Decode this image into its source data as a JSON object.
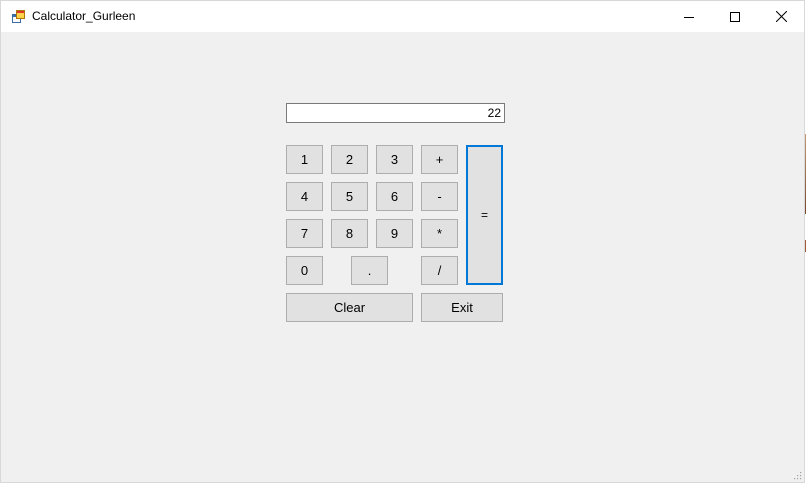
{
  "window": {
    "title": "Calculator_Gurleen",
    "icon": "windows-form-icon"
  },
  "titlebar_buttons": {
    "minimize": "minimize-icon",
    "maximize": "maximize-icon",
    "close": "close-icon"
  },
  "display": {
    "value": "22"
  },
  "buttons": {
    "one": "1",
    "two": "2",
    "three": "3",
    "plus": "+",
    "four": "4",
    "five": "5",
    "six": "6",
    "minus": "-",
    "seven": "7",
    "eight": "8",
    "nine": "9",
    "multiply": "*",
    "zero": "0",
    "dot": ".",
    "divide": "/",
    "equals": "=",
    "clear": "Clear",
    "exit": "Exit"
  },
  "colors": {
    "focus_border": "#0078d7",
    "button_bg": "#e1e1e1",
    "window_bg": "#f0f0f0"
  }
}
